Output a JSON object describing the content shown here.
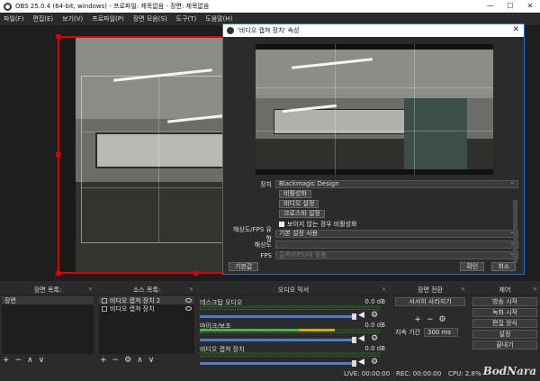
{
  "window": {
    "title": "OBS 25.0.4 (64-bit, windows) - 프로파일: 제목없음 - 장면: 제목없음",
    "minimize": "—",
    "maximize": "☐",
    "close": "✕"
  },
  "menu": [
    "파일(F)",
    "편집(E)",
    "보기(V)",
    "프로파일(P)",
    "장면 모음(S)",
    "도구(T)",
    "도움말(H)"
  ],
  "dialog": {
    "title": "'비디오 캡쳐 장치' 속성",
    "close": "✕",
    "device_label": "장치",
    "device_value": "Blackmagic Design",
    "btn_activate": "비활성화",
    "btn_video_settings": "비디오 설정",
    "btn_crossbar": "크로스바 설정",
    "checkbox_label": "보이지 않는 경우 비활성화",
    "res_type_label": "해상도/FPS 유형",
    "res_type_value": "기본 설정 사용",
    "resolution_label": "해상도",
    "resolution_value": "",
    "fps_label": "FPS",
    "fps_value": "출력(FPS)에 맞춤",
    "defaults_button": "기본값",
    "ok_button": "확인",
    "cancel_button": "취소"
  },
  "docks": {
    "scenes": {
      "title": "장면 목록:",
      "items": [
        "장면"
      ]
    },
    "sources": {
      "title": "소스 목록:",
      "items": [
        "비디오 캡쳐 장치 2",
        "비디오 캡쳐 장치"
      ]
    },
    "mixer": {
      "title": "오디오 믹서",
      "channels": [
        {
          "name": "데스크탑 오디오",
          "db": "0.0 dB",
          "level": 0.0
        },
        {
          "name": "마이크/보조",
          "db": "0.0 dB",
          "level": 0.75
        },
        {
          "name": "비디오 캡쳐 장치",
          "db": "0.0 dB",
          "level": 0.0
        }
      ]
    },
    "transitions": {
      "title": "장면 전환",
      "type": "서서히 사라지기",
      "duration_label": "지속 기간",
      "duration_value": "300 ms"
    },
    "controls": {
      "title": "제어",
      "buttons": [
        "방송 시작",
        "녹화 시작",
        "편집 방식",
        "설정",
        "끝내기"
      ]
    }
  },
  "status": {
    "live": "LIVE: 00:00:00",
    "rec": "REC: 00:00:00",
    "cpu": "CPU: 2.8%",
    "watermark": "BodNara"
  },
  "colors": {
    "selection": "#e00000",
    "dialog_border": "#1e6fd6",
    "slider": "#4a7fd0"
  }
}
